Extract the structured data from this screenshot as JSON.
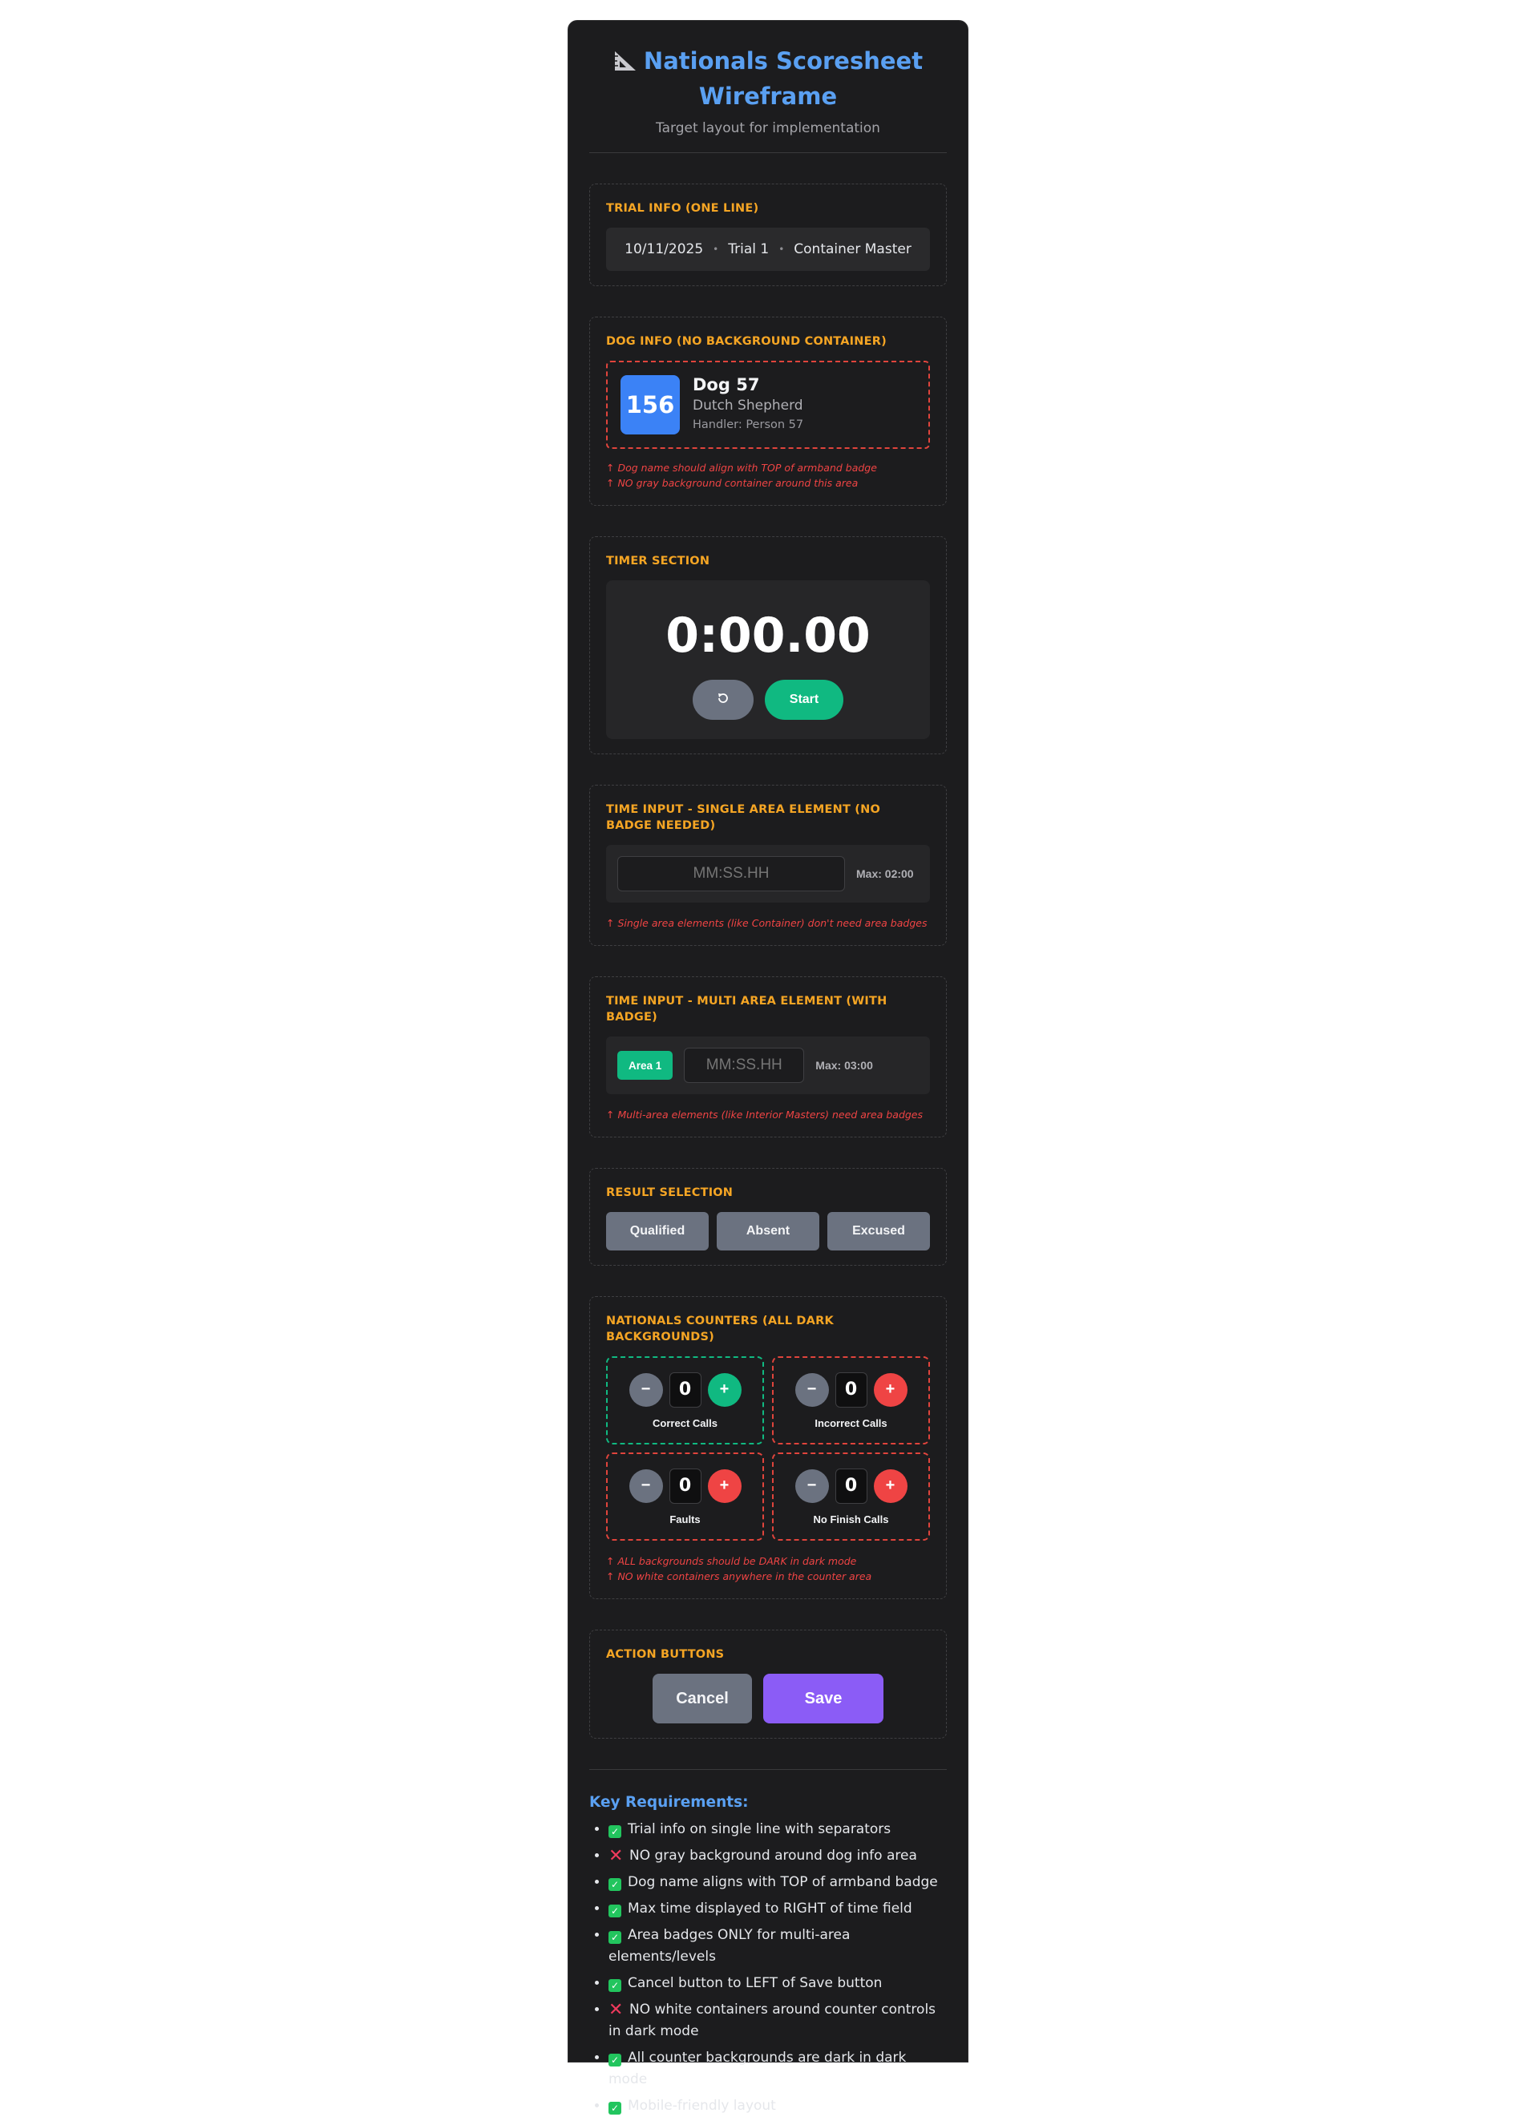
{
  "header": {
    "title": "Nationals Scoresheet Wireframe",
    "subtitle": "Target layout for implementation",
    "icon": "triangular-ruler-icon"
  },
  "trial": {
    "label": "TRIAL INFO (ONE LINE)",
    "date": "10/11/2025",
    "trial": "Trial 1",
    "element": "Container Master",
    "separator": "•"
  },
  "dog": {
    "label": "DOG INFO (NO BACKGROUND CONTAINER)",
    "armband": "156",
    "name": "Dog 57",
    "breed": "Dutch Shepherd",
    "handler": "Handler: Person 57",
    "notes": [
      "↑ Dog name should align with TOP of armband badge",
      "↑ NO gray background container around this area"
    ]
  },
  "timer": {
    "label": "TIMER SECTION",
    "display": "0:00.00",
    "reset_icon": "reset-icon",
    "start_label": "Start"
  },
  "time_single": {
    "label": "TIME INPUT - SINGLE AREA ELEMENT (NO BADGE NEEDED)",
    "placeholder": "MM:SS.HH",
    "max": "Max: 02:00",
    "note": "↑ Single area elements (like Container) don't need area badges"
  },
  "time_multi": {
    "label": "TIME INPUT - MULTI AREA ELEMENT (WITH BADGE)",
    "area_badge": "Area 1",
    "placeholder": "MM:SS.HH",
    "max": "Max: 03:00",
    "note": "↑ Multi-area elements (like Interior Masters) need area badges"
  },
  "result": {
    "label": "RESULT SELECTION",
    "options": [
      "Qualified",
      "Absent",
      "Excused"
    ]
  },
  "counters": {
    "label": "NATIONALS COUNTERS (ALL DARK BACKGROUNDS)",
    "items": [
      {
        "label": "Correct Calls",
        "value": "0",
        "accent": "#10b981"
      },
      {
        "label": "Incorrect Calls",
        "value": "0",
        "accent": "#ef4444"
      },
      {
        "label": "Faults",
        "value": "0",
        "accent": "#ef4444"
      },
      {
        "label": "No Finish Calls",
        "value": "0",
        "accent": "#ef4444"
      }
    ],
    "minus": "−",
    "plus": "+",
    "notes": [
      "↑ ALL backgrounds should be DARK in dark mode",
      "↑ NO white containers anywhere in the counter area"
    ]
  },
  "actions": {
    "label": "ACTION BUTTONS",
    "cancel": "Cancel",
    "save": "Save"
  },
  "requirements": {
    "title": "Key Requirements:",
    "items": [
      {
        "mark": "check",
        "text": "Trial info on single line with separators"
      },
      {
        "mark": "cross",
        "text": "NO gray background around dog info area"
      },
      {
        "mark": "check",
        "text": "Dog name aligns with TOP of armband badge"
      },
      {
        "mark": "check",
        "text": "Max time displayed to RIGHT of time field"
      },
      {
        "mark": "check",
        "text": "Area badges ONLY for multi-area elements/levels"
      },
      {
        "mark": "check",
        "text": "Cancel button to LEFT of Save button"
      },
      {
        "mark": "cross",
        "text": "NO white containers around counter controls in dark mode"
      },
      {
        "mark": "check",
        "text": "All counter backgrounds are dark in dark mode"
      },
      {
        "mark": "check",
        "text": "Mobile-friendly layout"
      }
    ]
  },
  "colors": {
    "accent_blue": "#5aa0f2",
    "label_orange": "#f5a524",
    "note_red": "#ef4444",
    "green": "#10b981",
    "purple": "#8b5cf6",
    "gray_button": "#6b7280"
  }
}
